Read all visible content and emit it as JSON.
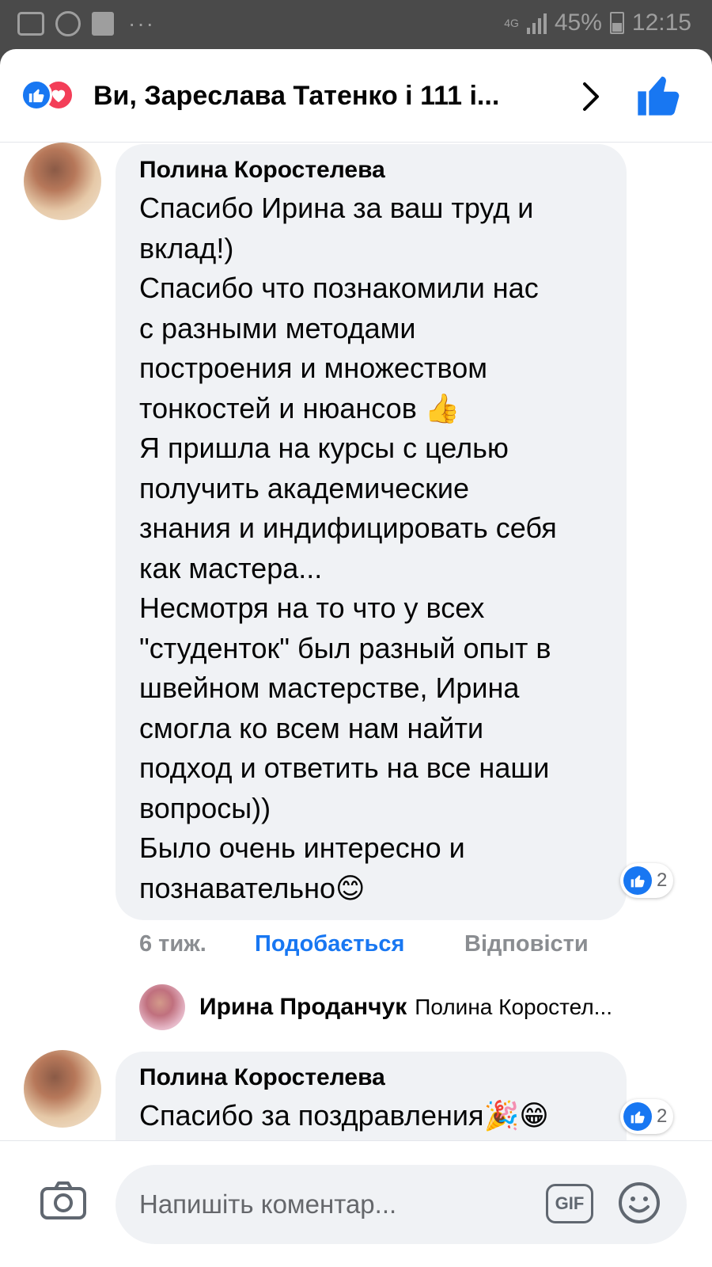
{
  "status_bar": {
    "network": "4G",
    "battery": "45%",
    "time": "12:15",
    "icons": [
      "gallery-icon",
      "viber-icon",
      "facebook-icon",
      "more-dots-icon"
    ]
  },
  "reactions_header": {
    "text": "Ви, Зарeслава Татенко і 111 і...",
    "icons": [
      "like-reaction-icon",
      "love-reaction-icon",
      "chevron-right-icon",
      "thumbs-up-icon"
    ]
  },
  "comments": [
    {
      "author": "Полина Коростелева",
      "lines": [
        "Спасибо Ирина за ваш труд и",
        "вклад!)",
        "Спасибо что познакомили нас",
        "с разными методами",
        "построения и множеством",
        "тонкостей и нюансов 👍",
        "Я пришла на курсы с целью",
        "получить академические",
        "знания и индифицировать себя",
        "как мастера...",
        "Несмотря на то что у всех",
        "\"студенток\" был разный опыт в",
        "швейном мастерстве, Ирина",
        "смогла ко всем нам найти",
        "подход и ответить на все наши",
        "вопросы))",
        "Было очень интересно и",
        "познавательно😊"
      ],
      "reaction_count": "2",
      "time": "6 тиж.",
      "like_label": "Подобається",
      "reply_label": "Відповісти"
    },
    {
      "author": "Полина Коростелева",
      "lines": [
        "Спасибо за поздравления🎉😁"
      ],
      "reaction_count": "2"
    }
  ],
  "reply_preview": {
    "author": "Ирина Проданчук",
    "text": "Полина Коростел..."
  },
  "composer": {
    "placeholder": "Напишіть коментар...",
    "gif_label": "GIF"
  },
  "colors": {
    "accent": "#1877f2",
    "love": "#f33e58",
    "bubble": "#f0f2f5",
    "muted": "#8a8d91",
    "statusbar": "#4a4a4a"
  }
}
